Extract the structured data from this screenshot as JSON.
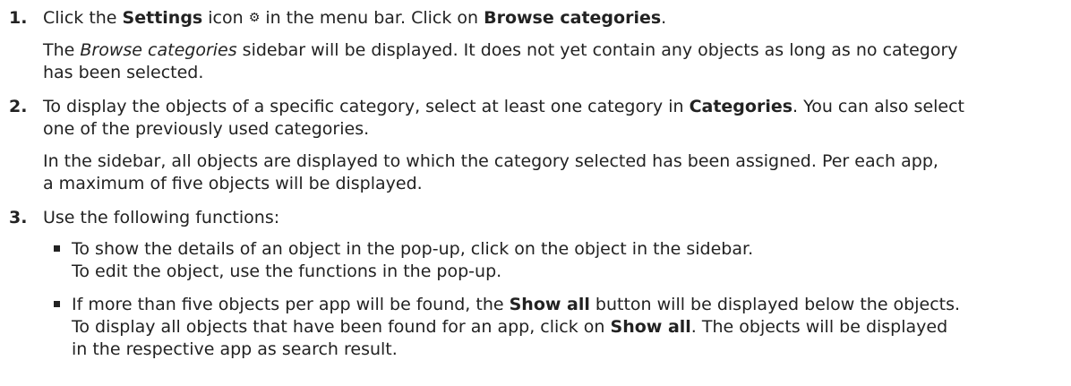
{
  "steps": [
    {
      "number": "1.",
      "line1": {
        "t1": "Click the ",
        "b1": "Settings",
        "t2": " icon ",
        "icon": "⚙",
        "t3": " in the menu bar. Click on ",
        "b2": "Browse categories",
        "t4": "."
      },
      "result": {
        "t1": "The ",
        "i1": "Browse categories",
        "t2": " sidebar will be displayed. It does not yet contain any objects as long as no category",
        "line2": "has been selected."
      }
    },
    {
      "number": "2.",
      "line1": {
        "t1": "To display the objects of a specific category, select at least one category in ",
        "b1": "Categories",
        "t2": ". You can also select"
      },
      "line2": "one of the previously used categories.",
      "result": {
        "line1": "In the sidebar, all objects are displayed to which the category selected has been assigned. Per each app,",
        "line2": "a maximum of five objects will be displayed."
      }
    },
    {
      "number": "3.",
      "line1": "Use the following functions:",
      "bullets": [
        {
          "line1": "To show the details of an object in the pop-up, click on the object in the sidebar.",
          "line2": "To edit the object, use the functions in the pop-up."
        },
        {
          "line1": {
            "t1": "If more than five objects per app will be found, the ",
            "b1": "Show all",
            "t2": " button will be displayed below the objects."
          },
          "line2": {
            "t1": "To display all objects that have been found for an app, click on ",
            "b1": "Show all",
            "t2": ". The objects will be displayed"
          },
          "line3": "in the respective app as search result."
        }
      ]
    }
  ]
}
